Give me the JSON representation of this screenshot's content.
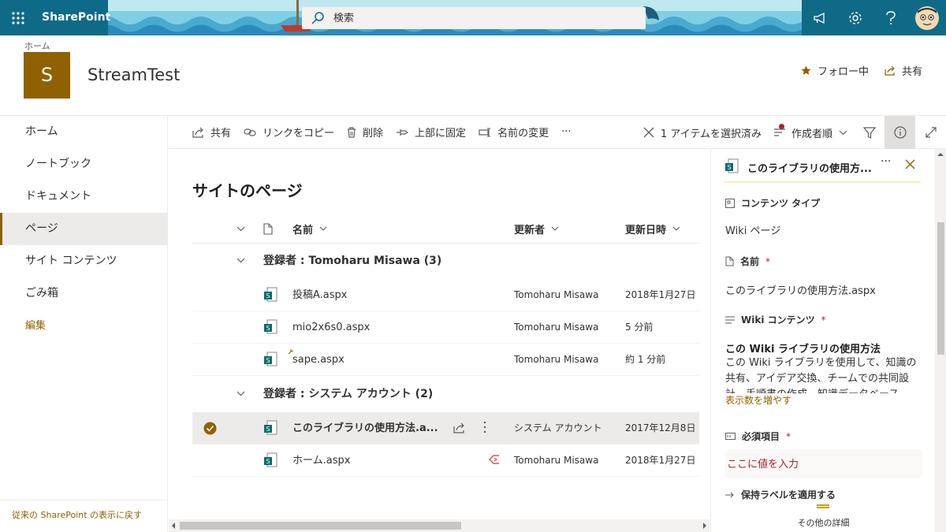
{
  "suite": {
    "brand": "SharePoint",
    "search_placeholder": "検索"
  },
  "site": {
    "home_link": "ホーム",
    "logo_letter": "S",
    "title": "StreamTest",
    "follow_label": "フォロー中",
    "share_label": "共有"
  },
  "nav": {
    "items": [
      {
        "label": "ホーム"
      },
      {
        "label": "ノートブック"
      },
      {
        "label": "ドキュメント"
      },
      {
        "label": "ページ",
        "selected": true
      },
      {
        "label": "サイト コンテンツ"
      },
      {
        "label": "ごみ箱"
      }
    ],
    "edit_label": "編集",
    "classic_link": "従来の SharePoint の表示に戻す"
  },
  "commands": {
    "share": "共有",
    "copy_link": "リンクをコピー",
    "delete": "削除",
    "pin_top": "上部に固定",
    "rename": "名前の変更",
    "more": "···",
    "selected_count": "1 アイテムを選択済み",
    "sort_label": "作成者順"
  },
  "list": {
    "page_title": "サイトのページ",
    "col_name": "名前",
    "col_editor": "更新者",
    "col_modified": "更新日時",
    "groups": [
      {
        "title": "登録者 : Tomoharu Misawa (3)",
        "rows": [
          {
            "name": "投稿A.aspx",
            "editor": "Tomoharu Misawa",
            "modified": "2018年1月27日"
          },
          {
            "name": "mio2x6s0.aspx",
            "editor": "Tomoharu Misawa",
            "modified": "5 分前"
          },
          {
            "name": "sape.aspx",
            "editor": "Tomoharu Misawa",
            "modified": "約 1 分前"
          }
        ]
      },
      {
        "title": "登録者 : システム アカウント (2)",
        "rows": [
          {
            "name": "このライブラリの使用方法.a...",
            "editor": "システム アカウント",
            "modified": "2017年12月8日"
          },
          {
            "name": "ホーム.aspx",
            "editor": "Tomoharu Misawa",
            "modified": "2018年1月27日"
          }
        ]
      }
    ]
  },
  "pane": {
    "title": "このライブラリの使用方...",
    "more": "···",
    "content_type_label": "コンテンツ タイプ",
    "content_type_value": "Wiki ページ",
    "name_label": "名前",
    "required_mark": "*",
    "name_value": "このライブラリの使用方法.aspx",
    "wiki_label": "Wiki コンテンツ",
    "wiki_heading": "この Wiki ライブラリの使用方法",
    "wiki_body": "この Wiki ライブラリを使用して、知識の共有、アイデア交換、チームでの共同設計、手順書の作成、知識データベース",
    "show_more": "表示数を増やす",
    "required_field_label": "必須項目",
    "required_field_placeholder": "ここに値を入力",
    "retention_label": "保持ラベルを適用する",
    "more_details": "その他の詳細"
  },
  "colors": {
    "suite": "#0f6a88",
    "accent": "#8f6100",
    "required": "#a4262c"
  }
}
